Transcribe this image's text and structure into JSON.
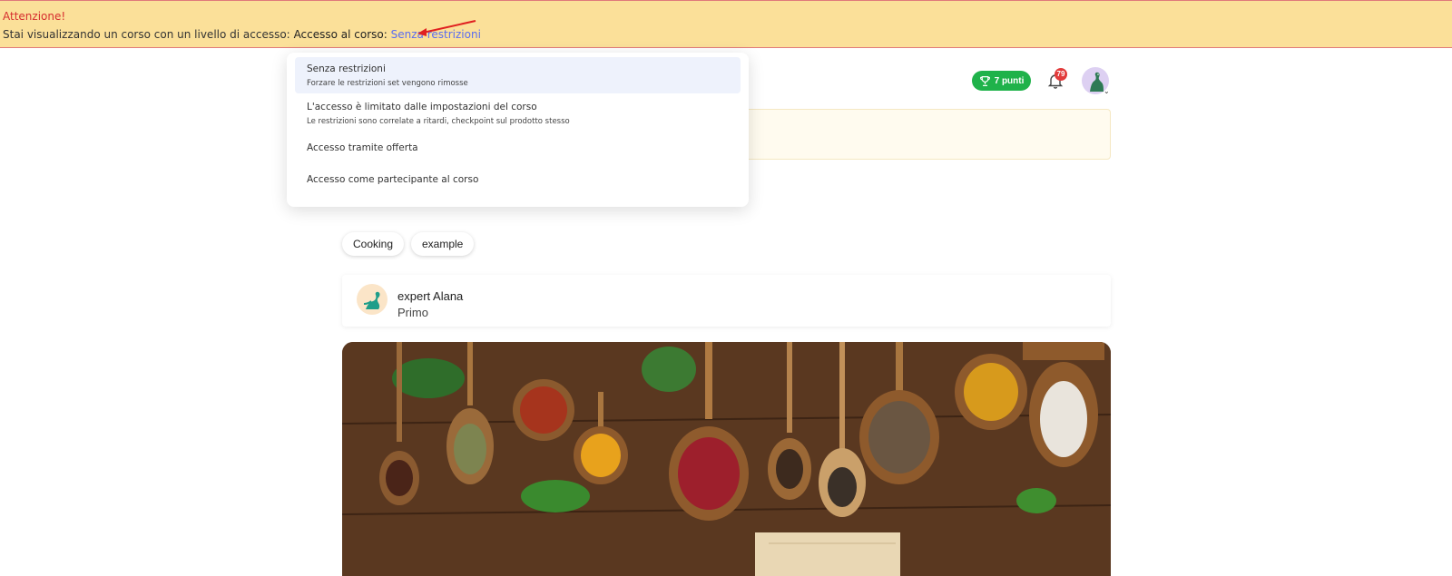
{
  "banner": {
    "title": "Attenzione!",
    "message": "Stai visualizzando un corso con un livello di accesso:",
    "course_label": "Accesso al corso:",
    "access_link": "Senza restrizioni"
  },
  "header": {
    "points_label": "7 punti",
    "notifications_count": "79",
    "colors": {
      "points_bg": "#1fb24a",
      "badge_bg": "#e23b3b"
    }
  },
  "dropdown": {
    "options": [
      {
        "title": "Senza restrizioni",
        "description": "Forzare le restrizioni set vengono rimosse"
      },
      {
        "title": "L'accesso è limitato dalle impostazioni del corso",
        "description": "Le restrizioni sono correlate a ritardi, checkpoint sul prodotto stesso"
      },
      {
        "title": "Accesso tramite offerta"
      },
      {
        "title": "Accesso come partecipante al corso"
      }
    ]
  },
  "course": {
    "tags": [
      "Cooking",
      "example"
    ],
    "author": {
      "name": "expert Alana",
      "role": "Primo"
    },
    "hero_icon": "spices-image"
  },
  "colors": {
    "banner_bg": "#fbe099",
    "warning_text": "#d62f2f",
    "link": "#5a6cf0"
  }
}
